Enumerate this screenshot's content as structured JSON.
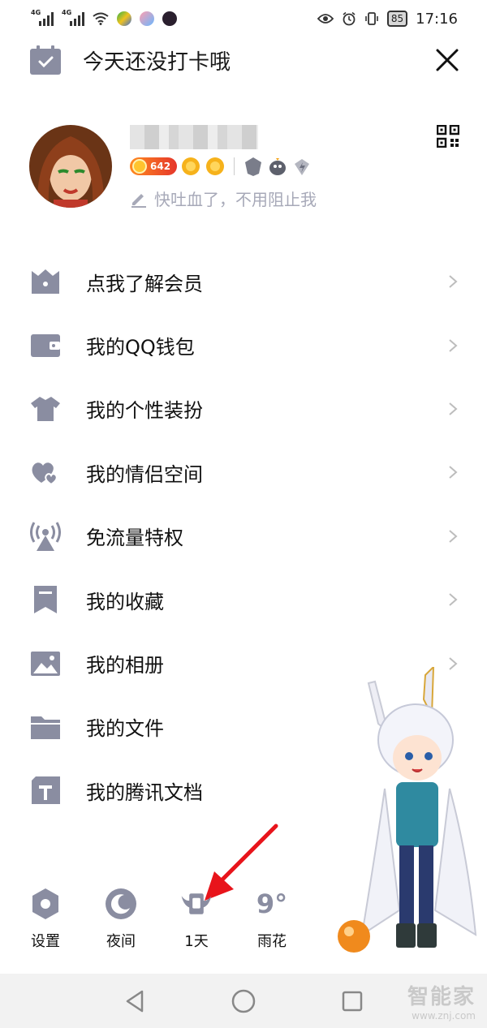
{
  "status_bar": {
    "network_1": "4G",
    "network_2": "4G",
    "battery": "85",
    "time": "17:16"
  },
  "header": {
    "checkin_title": "今天还没打卡哦"
  },
  "profile": {
    "level_badge": "642",
    "signature": "快吐血了，不用阻止我"
  },
  "menu": [
    {
      "label": "点我了解会员",
      "icon": "membership-icon"
    },
    {
      "label": "我的QQ钱包",
      "icon": "wallet-icon"
    },
    {
      "label": "我的个性装扮",
      "icon": "shirt-icon"
    },
    {
      "label": "我的情侣空间",
      "icon": "hearts-icon"
    },
    {
      "label": "免流量特权",
      "icon": "signal-tower-icon"
    },
    {
      "label": "我的收藏",
      "icon": "bookmark-icon"
    },
    {
      "label": "我的相册",
      "icon": "image-icon"
    },
    {
      "label": "我的文件",
      "icon": "folder-icon"
    },
    {
      "label": "我的腾讯文档",
      "icon": "document-icon"
    }
  ],
  "bottom_actions": {
    "settings": "设置",
    "night": "夜间",
    "streak": "1天",
    "weather_temp": "9°",
    "weather": "雨花"
  },
  "watermark": {
    "brand": "智能家",
    "url": "www.znj.com"
  },
  "colors": {
    "icon_gray": "#8a8da1",
    "arrow_red": "#e8141b",
    "nav_bg": "#f2f2f2"
  }
}
